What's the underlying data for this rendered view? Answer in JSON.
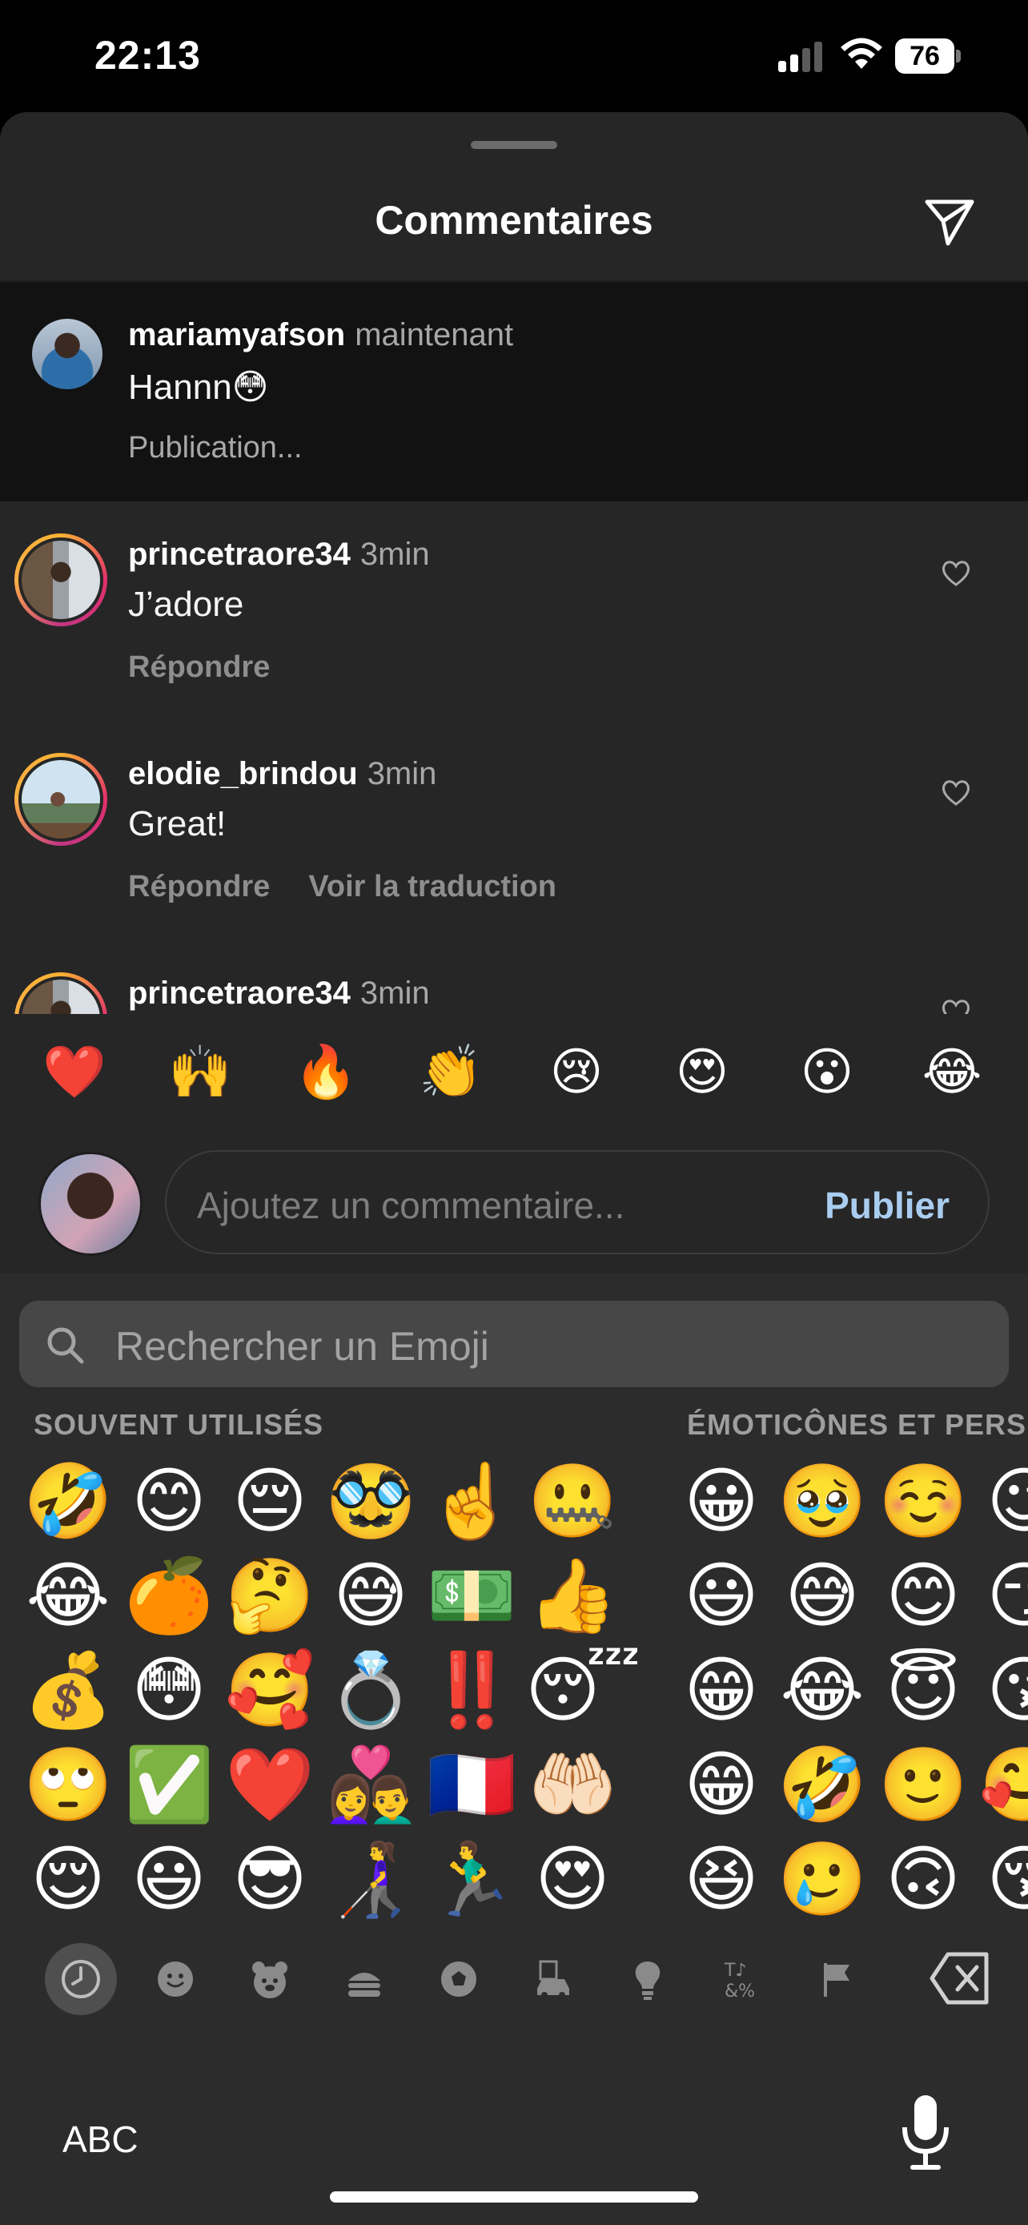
{
  "status_bar": {
    "time": "22:13",
    "battery": "76"
  },
  "sheet": {
    "title": "Commentaires",
    "send_icon": "send-icon"
  },
  "comments": [
    {
      "username": "mariamyafson",
      "time": "maintenant",
      "text": "Hannn😳",
      "status": "Publication...",
      "highlighted": true
    },
    {
      "username": "princetraore34",
      "time": "3min",
      "text": "J’adore",
      "actions": [
        "Répondre"
      ]
    },
    {
      "username": "elodie_brindou",
      "time": "3min",
      "text": "Great!",
      "actions": [
        "Répondre",
        "Voir la traduction"
      ]
    },
    {
      "username": "princetraore34",
      "time": "3min",
      "text": "",
      "actions": []
    }
  ],
  "quick_reactions": [
    "❤️",
    "🙌",
    "🔥",
    "👏",
    "😢",
    "😍",
    "😮",
    "😂"
  ],
  "composer": {
    "placeholder": "Ajoutez un commentaire...",
    "publish_label": "Publier"
  },
  "keyboard": {
    "search_placeholder": "Rechercher un Emoji",
    "section_frequent": "SOUVENT UTILISÉS",
    "section_smileys": "ÉMOTICÔNES ET PERS",
    "frequent_emojis": [
      [
        "🤣",
        "😊",
        "😔",
        "🥸",
        "☝️",
        "🤐"
      ],
      [
        "😂",
        "🍊",
        "🤔",
        "😅",
        "💵",
        "👍"
      ],
      [
        "💰",
        "😳",
        "🥰",
        "💍",
        "‼️",
        "😴"
      ],
      [
        "🙄",
        "✅",
        "❤️",
        "👩‍❤️‍👨",
        "🇫🇷",
        "🤲🏻"
      ],
      [
        "😌",
        "😃",
        "😎",
        "👩‍🦯",
        "🏃‍♂️",
        "😍"
      ]
    ],
    "smiley_emojis": [
      [
        "😀",
        "🥹",
        "☺️",
        "😉"
      ],
      [
        "😃",
        "😅",
        "😊",
        "😏"
      ],
      [
        "😁",
        "😂",
        "😇",
        "😘"
      ],
      [
        "😁",
        "🤣",
        "🙂",
        "🥰"
      ],
      [
        "😆",
        "🥲",
        "🙃",
        "😚"
      ]
    ],
    "categories": [
      "clock-icon",
      "smiley-icon",
      "bear-icon",
      "food-icon",
      "ball-icon",
      "car-icon",
      "bulb-icon",
      "symbols-icon",
      "flag-icon"
    ],
    "abc_label": "ABC"
  }
}
